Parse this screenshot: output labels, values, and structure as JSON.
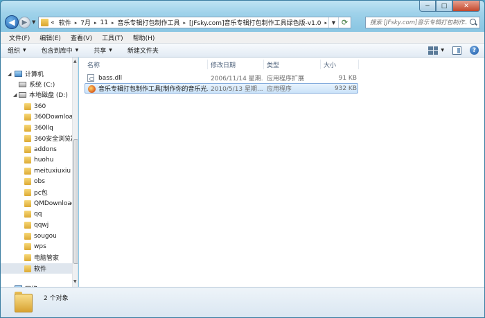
{
  "window": {
    "caption_buttons": {
      "minimize": "─",
      "maximize": "□",
      "close": "✕"
    }
  },
  "nav_buttons": {
    "back": "◀",
    "forward": "▶",
    "dropdown": "▼"
  },
  "address": {
    "overflow": "«",
    "crumbs": [
      "软件",
      "7月",
      "11",
      "音乐专辑打包制作工具",
      "[JFsky.com]音乐专辑打包制作工具绿色版-v1.0"
    ],
    "separator": "▸"
  },
  "search": {
    "placeholder": "搜索 [JFsky.com]音乐专辑打包制作..."
  },
  "menubar": {
    "items": [
      "文件(F)",
      "编辑(E)",
      "查看(V)",
      "工具(T)",
      "帮助(H)"
    ]
  },
  "commands": {
    "organize": "组织",
    "include_library": "包含到库中",
    "share": "共享",
    "new_folder": "新建文件夹"
  },
  "navpane": {
    "computer": "计算机",
    "drive_c": "系统 (C:)",
    "drive_d": "本地磁盘 (D:)",
    "folders": [
      "360",
      "360Download",
      "360llq",
      "360安全浏览器",
      "addons",
      "huohu",
      "meituxiuxiu",
      "obs",
      "pc包",
      "QMDownload",
      "qq",
      "qqwj",
      "sougou",
      "wps",
      "电脑管家",
      "软件"
    ],
    "selected_folder": "软件",
    "network": "网络"
  },
  "columns": {
    "name": "名称",
    "modified": "修改日期",
    "type": "类型",
    "size": "大小"
  },
  "files": [
    {
      "name": "bass.dll",
      "modified": "2006/11/14 星期...",
      "type": "应用程序扩展",
      "size": "91 KB",
      "icon": "dll-icon"
    },
    {
      "name": "音乐专辑打包制作工具[制作你的音乐光...",
      "modified": "2010/5/13 星期...",
      "type": "应用程序",
      "size": "932 KB",
      "icon": "app-icon"
    }
  ],
  "details": {
    "count": "2 个对象"
  }
}
